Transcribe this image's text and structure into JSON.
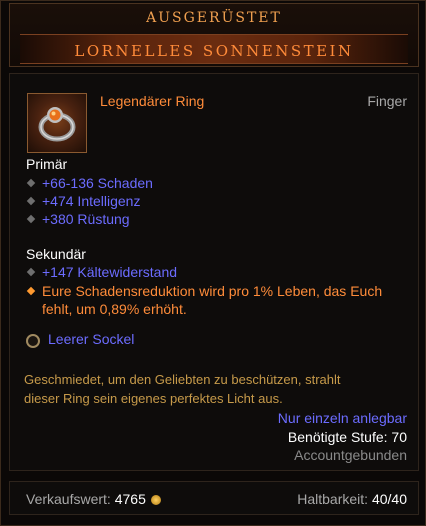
{
  "header": {
    "equipped_label": "AUSGERÜSTET",
    "item_name": "LORNELLES SONNENSTEIN"
  },
  "item": {
    "type": "Legendärer Ring",
    "slot": "Finger",
    "icon": "ring-icon"
  },
  "primary": {
    "label": "Primär",
    "stats": [
      "+66-136 Schaden",
      "+474 Intelligenz",
      "+380 Rüstung"
    ]
  },
  "secondary": {
    "label": "Sekundär",
    "stats": [
      "+147 Kältewiderstand"
    ],
    "legendary_line1": "Eure Schadensreduktion wird pro 1% Leben, das Euch",
    "legendary_line2": "fehlt, um 0,89% erhöht."
  },
  "socket": {
    "label": "Leerer Sockel"
  },
  "flavor": {
    "line1": "Geschmiedet, um den Geliebten zu beschützen, strahlt",
    "line2": "dieser Ring sein eigenes perfektes Licht aus."
  },
  "requirements": {
    "unique": "Nur einzeln anlegbar",
    "level": "Benötigte Stufe: 70",
    "account": "Accountgebunden"
  },
  "footer": {
    "sell_label": "Verkaufswert:",
    "sell_value": "4765",
    "durability_label": "Haltbarkeit:",
    "durability_value": "40/40"
  },
  "colors": {
    "legendary": "#ff8c3a",
    "magic": "#6c6cff",
    "flavor": "#c69a4a"
  }
}
